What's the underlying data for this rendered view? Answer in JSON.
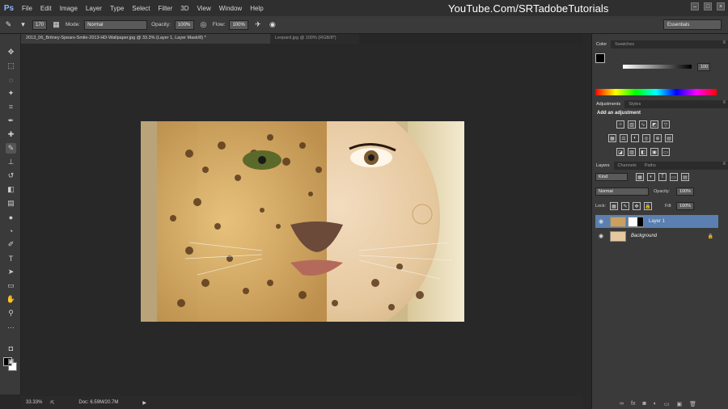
{
  "app": {
    "logo": "Ps"
  },
  "menu": [
    "File",
    "Edit",
    "Image",
    "Layer",
    "Type",
    "Select",
    "Filter",
    "3D",
    "View",
    "Window",
    "Help"
  ],
  "watermark": "YouTube.Com/SRTadobeTutorials",
  "options": {
    "brush_size": "170",
    "mode_label": "Mode:",
    "mode_value": "Normal",
    "opacity_label": "Opacity:",
    "opacity_value": "100%",
    "flow_label": "Flow:",
    "flow_value": "100%",
    "workspace": "Essentials"
  },
  "tabs": [
    {
      "label": "2013_06_Britney-Spears-Smile-2013-HD-Wallpaper.jpg @ 33.3% (Layer 1, Layer Mask/8) *"
    },
    {
      "label": "Leopard.jpg @ 100% (RGB/8*)"
    }
  ],
  "status": {
    "zoom": "33.33%",
    "doc": "Doc: 6.59M/20.7M"
  },
  "color_panel": {
    "tabs": [
      "Color",
      "Swatches"
    ],
    "k_value": "100"
  },
  "adjustments_panel": {
    "tabs": [
      "Adjustments",
      "Styles"
    ],
    "title": "Add an adjustment"
  },
  "layers_panel": {
    "tabs": [
      "Layers",
      "Channels",
      "Paths"
    ],
    "kind": "Kind",
    "blend_mode": "Normal",
    "opacity_label": "Opacity:",
    "opacity_value": "100%",
    "lock_label": "Lock:",
    "fill_label": "Fill:",
    "fill_value": "100%",
    "layers": [
      {
        "name": "Layer 1",
        "selected": true
      },
      {
        "name": "Background",
        "selected": false
      }
    ]
  },
  "colors": {
    "accent": "#5a7fb0",
    "foreground": "#000000",
    "background": "#ffffff"
  }
}
